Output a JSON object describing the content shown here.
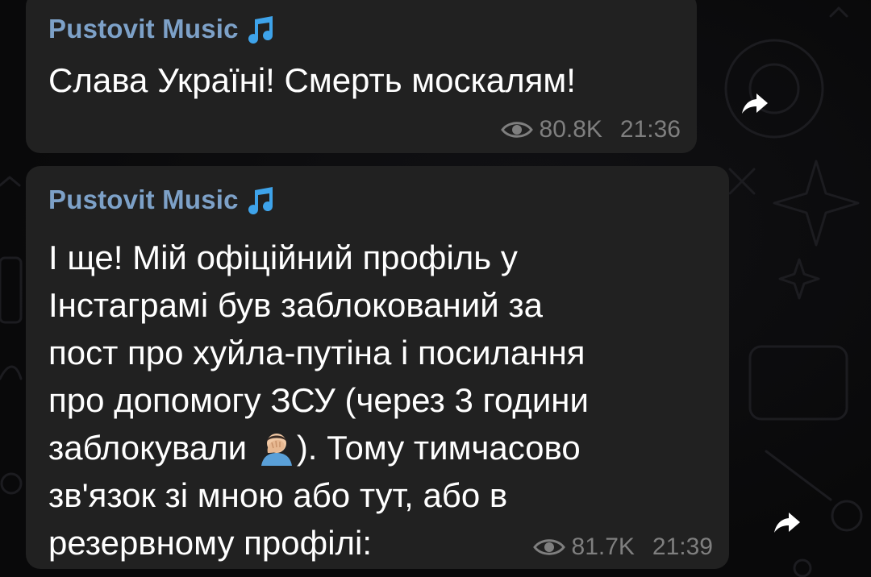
{
  "messages": [
    {
      "author": "Pustovit Music",
      "text": "Слава Україні! Смерть москалям!",
      "views": "80.8K",
      "time": "21:36"
    },
    {
      "author": "Pustovit Music",
      "text_before_emoji": "І ще! Мій офіційний профіль у\nІнстаграмі був заблокований за\nпост про хуйла-путіна і посилання\nпро допомогу ЗСУ (через 3 години\nзаблокували ",
      "text_after_emoji": "). Тому тимчасово\nзв'язок зі мною або тут, або в\nрезервному профілі:",
      "emoji": "facepalm-emoji",
      "views": "81.7K",
      "time": "21:39"
    }
  ],
  "icons": {
    "author_badge": "music-note-icon",
    "views": "eye-icon",
    "share": "share-arrow-icon"
  },
  "colors": {
    "background": "#0b0b0d",
    "bubble": "#212121",
    "author": "#7da1c8",
    "text": "#ffffff",
    "meta": "#7f7f7f",
    "note_icon": "#3ea3ea"
  }
}
